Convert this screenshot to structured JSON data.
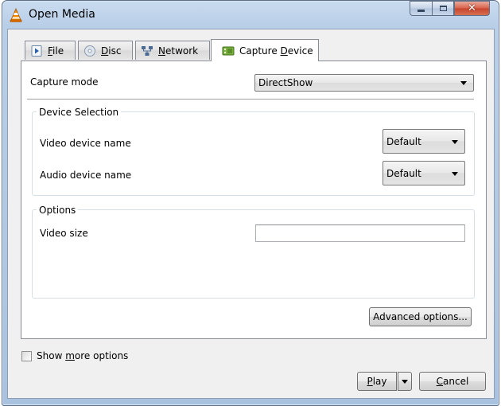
{
  "window": {
    "title": "Open Media",
    "minimize": "–",
    "maximize": "□",
    "close": "✕"
  },
  "tabs": [
    {
      "pre": "",
      "mnemonic": "F",
      "post": "ile",
      "icon": "file-icon"
    },
    {
      "pre": "",
      "mnemonic": "D",
      "post": "isc",
      "icon": "disc-icon"
    },
    {
      "pre": "",
      "mnemonic": "N",
      "post": "etwork",
      "icon": "network-icon"
    },
    {
      "pre": "Capture ",
      "mnemonic": "D",
      "post": "evice",
      "icon": "capture-device-icon"
    }
  ],
  "active_tab": "Capture Device",
  "capture_mode": {
    "label": "Capture mode",
    "value": "DirectShow"
  },
  "device_selection": {
    "title": "Device Selection",
    "video_label": "Video device name",
    "video_value": "Default",
    "audio_label": "Audio device name",
    "audio_value": "Default"
  },
  "options": {
    "title": "Options",
    "video_size_label": "Video size",
    "video_size_value": ""
  },
  "advanced_button": "Advanced options...",
  "show_more": {
    "pre": "Show ",
    "mnemonic": "m",
    "post": "ore options",
    "checked": false
  },
  "play_button": {
    "mnemonic": "P",
    "post": "lay"
  },
  "cancel_button": {
    "mnemonic": "C",
    "post": "ancel"
  }
}
